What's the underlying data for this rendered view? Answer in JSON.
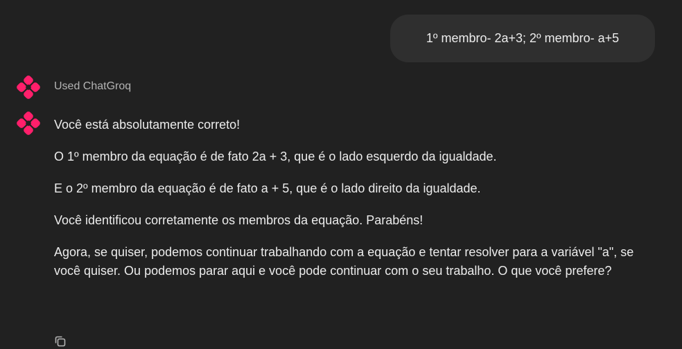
{
  "user_message": {
    "text": "1º membro- 2a+3; 2º membro- a+5"
  },
  "tool_call": {
    "label": "Used ChatGroq"
  },
  "assistant_message": {
    "paragraphs": [
      "Você está absolutamente correto!",
      "O 1º membro da equação é de fato 2a + 3, que é o lado esquerdo da igualdade.",
      "E o 2º membro da equação é de fato a + 5, que é o lado direito da igualdade.",
      "Você identificou corretamente os membros da equação. Parabéns!",
      "Agora, se quiser, podemos continuar trabalhando com a equação e tentar resolver para a variável \"a\", se você quiser. Ou podemos parar aqui e você pode continuar com o seu trabalho. O que você prefere?"
    ]
  },
  "actions": {
    "copy_icon": "copy-icon"
  },
  "colors": {
    "background": "#212121",
    "user_bubble": "#2f2f2f",
    "text": "#ececec",
    "muted_text": "#b4b4b4",
    "logo_accent": "#ff1f6b"
  }
}
